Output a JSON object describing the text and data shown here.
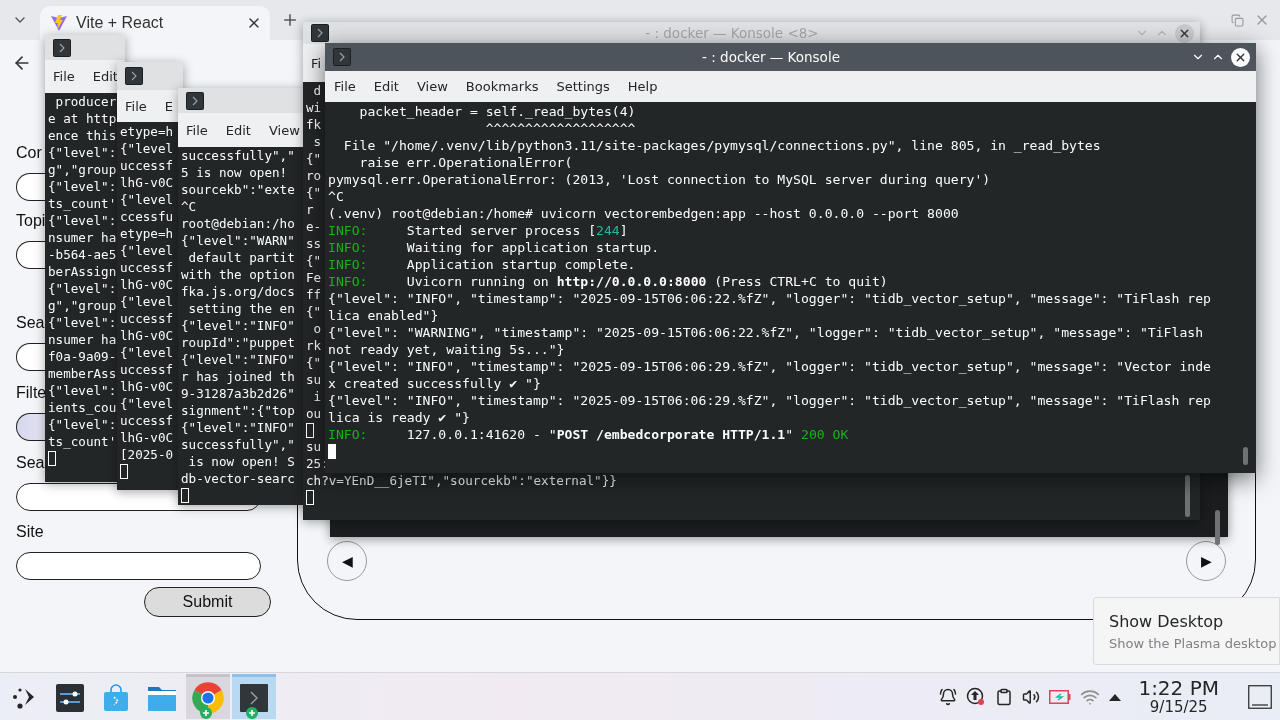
{
  "browser": {
    "tab_title": "Vite + React",
    "form": {
      "fields": [
        {
          "label": "Cor",
          "kind": "text"
        },
        {
          "label": "Topi",
          "kind": "text"
        },
        {
          "label": "Sea",
          "kind": "text"
        },
        {
          "label": "Filte",
          "kind": "select"
        },
        {
          "label": "Sea",
          "kind": "text"
        },
        {
          "label": "Site",
          "kind": "text"
        }
      ],
      "submit": "Submit"
    },
    "carousel": {
      "prev": "◀",
      "next": "▶"
    }
  },
  "terminals": [
    {
      "active": false,
      "menu": [
        "File",
        "Edit"
      ],
      "cursor": true,
      "lines": [
        " producer",
        "e at http",
        "ence this",
        "{\"level\":",
        "g\",\"group",
        "{\"level\":",
        "ts_count'",
        "{\"level\":",
        "nsumer ha",
        "-b564-ae5",
        "berAssign",
        "{\"level\":",
        "g\",\"group",
        "{\"level\":",
        "nsumer ha",
        "f0a-9a09-",
        "memberAss",
        "{\"level\":",
        "ients_cou",
        "{\"level\":",
        "ts_count'"
      ]
    },
    {
      "active": false,
      "menu": [
        "File",
        "E"
      ],
      "cursor": true,
      "lines": [
        "etype=h",
        "{\"level",
        "uccessf",
        "lhG-v0C",
        "{\"level",
        "ccessfu",
        "etype=h",
        "{\"level",
        "uccessf",
        "lhG-v0C",
        "{\"level",
        "uccessf",
        "lhG-v0C",
        "{\"level",
        "uccessf",
        "lhG-v0C",
        "{\"level",
        "uccessf",
        "lhG-v0C",
        "[2025-0"
      ]
    },
    {
      "active": false,
      "menu": [
        "File",
        "Edit",
        "View"
      ],
      "cursor": true,
      "lines": [
        "successfully\",\"",
        "5 is now open!",
        "sourcekb\":\"exte",
        "^C",
        "root@debian:/ho",
        "{\"level\":\"WARN\"",
        " default partit",
        "with the option",
        "fka.js.org/docs",
        " setting the en",
        "{\"level\":\"INFO\"",
        "roupId\":\"puppet",
        "{\"level\":\"INFO\"",
        "r has joined th",
        "9-31287a3b2d26\"",
        "signment\":{\"top",
        "{\"level\":\"INFO\"",
        "successfully\",\"",
        " is now open! S",
        "db-vector-searc"
      ]
    },
    {
      "active": false,
      "title": "- : docker — Konsole <8>",
      "menu": [
        "Fi"
      ],
      "cursor": true,
      "lines": [
        " d",
        "wi",
        "fk",
        " s",
        "{\"",
        "ro",
        "{\"",
        "r ",
        "e-",
        "ss",
        "{\"",
        "Fe",
        "ff",
        "{\"",
        " o",
        "rk",
        "{\"",
        "su",
        " i",
        "ou",
        {
          "kind": "cursor"
        },
        "su",
        "25:",
        "ch?v=YEnD__6jeTI\",\"sourcekb\":\"external\"}}"
      ]
    },
    {
      "active": true,
      "title": "- : docker — Konsole",
      "menu": [
        "File",
        "Edit",
        "View",
        "Bookmarks",
        "Settings",
        "Help"
      ],
      "cursor": true,
      "lines": [
        "    packet_header = self._read_bytes(4)",
        "                    ^^^^^^^^^^^^^^^^^^^",
        "  File \"/home/.venv/lib/python3.11/site-packages/pymysql/connections.py\", line 805, in _read_bytes",
        "    raise err.OperationalError(",
        "pymysql.err.OperationalError: (2013, 'Lost connection to MySQL server during query')",
        "^C",
        "(.venv) root@debian:/home# uvicorn vectorembedgen:app --host 0.0.0.0 --port 8000",
        [
          {
            "kind": "label",
            "text": "INFO:"
          },
          {
            "kind": "plain",
            "text": "     Started server process ["
          },
          {
            "kind": "number",
            "text": "244"
          },
          {
            "kind": "plain",
            "text": "]"
          }
        ],
        [
          {
            "kind": "label",
            "text": "INFO:"
          },
          {
            "kind": "plain",
            "text": "     Waiting for application startup."
          }
        ],
        [
          {
            "kind": "label",
            "text": "INFO:"
          },
          {
            "kind": "plain",
            "text": "     Application startup complete."
          }
        ],
        [
          {
            "kind": "label",
            "text": "INFO:"
          },
          {
            "kind": "plain",
            "text": "     Uvicorn running on "
          },
          {
            "kind": "bold",
            "text": "http://0.0.0.0:8000"
          },
          {
            "kind": "plain",
            "text": " (Press CTRL+C to quit)"
          }
        ],
        "{\"level\": \"INFO\", \"timestamp\": \"2025-09-15T06:06:22.%fZ\", \"logger\": \"tidb_vector_setup\", \"message\": \"TiFlash rep",
        "lica enabled\"}",
        "{\"level\": \"WARNING\", \"timestamp\": \"2025-09-15T06:06:22.%fZ\", \"logger\": \"tidb_vector_setup\", \"message\": \"TiFlash",
        "not ready yet, waiting 5s...\"}",
        "{\"level\": \"INFO\", \"timestamp\": \"2025-09-15T06:06:29.%fZ\", \"logger\": \"tidb_vector_setup\", \"message\": \"Vector inde",
        "x created successfully ✔ \"}",
        "{\"level\": \"INFO\", \"timestamp\": \"2025-09-15T06:06:29.%fZ\", \"logger\": \"tidb_vector_setup\", \"message\": \"TiFlash rep",
        "lica is ready ✔ \"}",
        [
          {
            "kind": "label",
            "text": "INFO:"
          },
          {
            "kind": "plain",
            "text": "     127.0.0.1:41620 - \""
          },
          {
            "kind": "bold",
            "text": "POST /embedcorporate HTTP/1.1"
          },
          {
            "kind": "plain",
            "text": "\" "
          },
          {
            "kind": "ok",
            "text": "200 OK"
          }
        ]
      ]
    }
  ],
  "tooltip": {
    "title": "Show Desktop",
    "subtitle": "Show the Plasma desktop"
  },
  "taskbar": {
    "apps": [
      {
        "kind": "launcher",
        "running": false,
        "selected": false
      },
      {
        "kind": "settings",
        "running": false,
        "selected": false
      },
      {
        "kind": "store",
        "running": false,
        "selected": false
      },
      {
        "kind": "files",
        "running": false,
        "selected": false
      },
      {
        "kind": "browser",
        "running": true,
        "selected": false
      },
      {
        "kind": "terminal",
        "running": true,
        "selected": true
      }
    ],
    "clock": {
      "time": "1:22 PM",
      "date": "9/15/25"
    }
  }
}
